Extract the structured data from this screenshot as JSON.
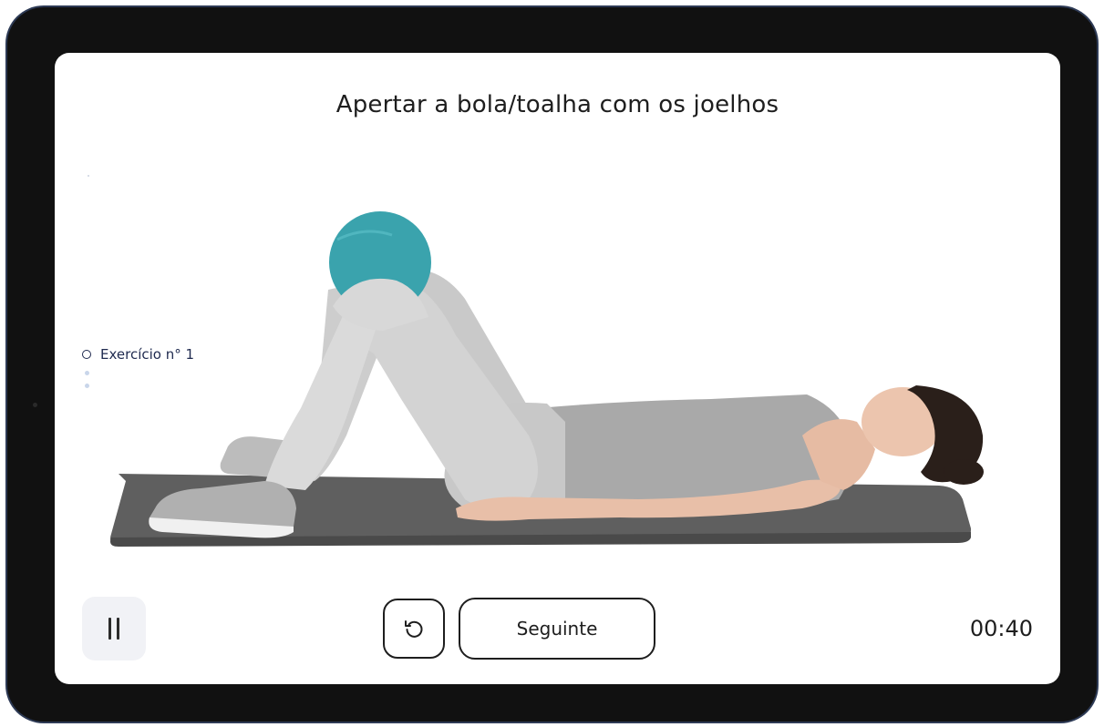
{
  "exercise": {
    "title": "Apertar a bola/toalha com os joelhos"
  },
  "progress": {
    "current_label": "Exercício n° 1",
    "remaining_steps": 2
  },
  "controls": {
    "pause_icon": "pause-icon",
    "restart_icon": "restart-icon",
    "next_label": "Seguinte"
  },
  "timer": {
    "value": "00:40"
  },
  "colors": {
    "accent": "#1f2a4f",
    "ball": "#3aa3ad",
    "mat": "#5f5f5f",
    "device_frame": "#111111"
  }
}
